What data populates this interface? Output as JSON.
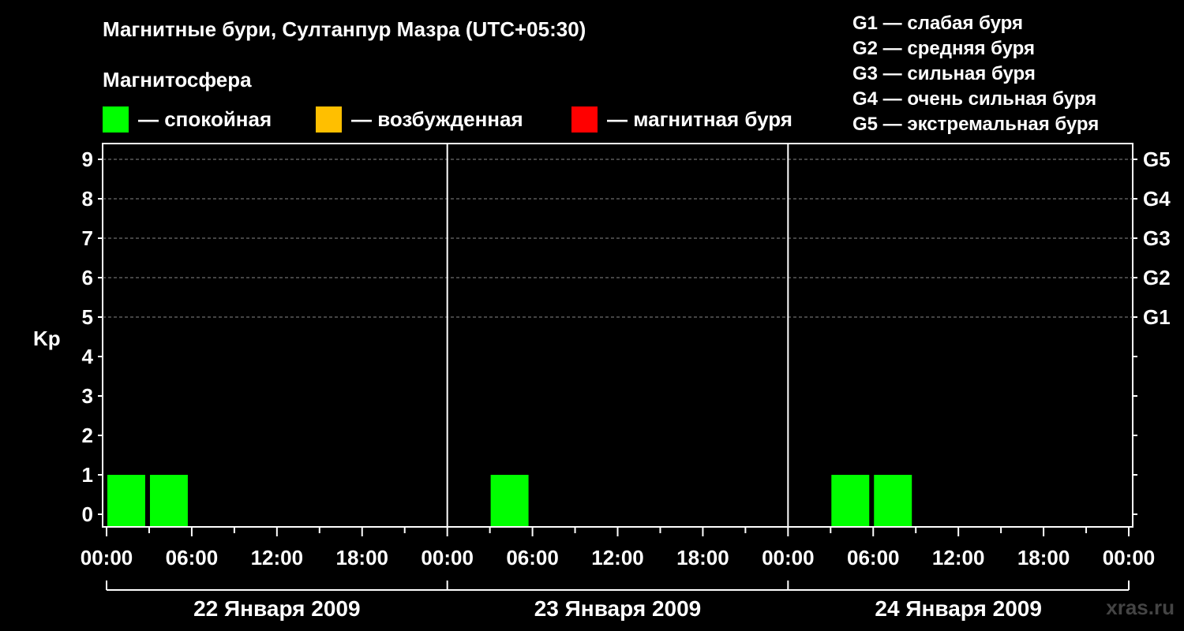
{
  "chart_data": {
    "type": "bar",
    "title": "Магнитные бури, Султанпур Мазра (UTC+05:30)",
    "legend_title": "Магнитосфера",
    "legend": [
      {
        "label": "— спокойная",
        "color": "#00ff00"
      },
      {
        "label": "— возбужденная",
        "color": "#ffbf00"
      },
      {
        "label": "— магнитная буря",
        "color": "#ff0000"
      }
    ],
    "g_scale": [
      "G1 — слабая буря",
      "G2 — средняя буря",
      "G3 — сильная буря",
      "G4 — очень сильная буря",
      "G5 — экстремальная буря"
    ],
    "ylabel": "Kp",
    "ylim": [
      0,
      9
    ],
    "yticks": [
      "0",
      "1",
      "2",
      "3",
      "4",
      "5",
      "6",
      "7",
      "8",
      "9"
    ],
    "right_ticks": [
      {
        "kp": 5,
        "label": "G1"
      },
      {
        "kp": 6,
        "label": "G2"
      },
      {
        "kp": 7,
        "label": "G3"
      },
      {
        "kp": 8,
        "label": "G4"
      },
      {
        "kp": 9,
        "label": "G5"
      }
    ],
    "x_time_labels": [
      "00:00",
      "06:00",
      "12:00",
      "18:00",
      "00:00",
      "06:00",
      "12:00",
      "18:00",
      "00:00",
      "06:00",
      "12:00",
      "18:00",
      "00:00"
    ],
    "days": [
      "22 Января 2009",
      "23 Января 2009",
      "24 Января 2009"
    ],
    "bars": [
      {
        "day": 0,
        "start_hour": 0,
        "end_hour": 3,
        "kp": 1,
        "status": "quiet"
      },
      {
        "day": 0,
        "start_hour": 3,
        "end_hour": 6,
        "kp": 1,
        "status": "quiet"
      },
      {
        "day": 1,
        "start_hour": 3,
        "end_hour": 6,
        "kp": 1,
        "status": "quiet"
      },
      {
        "day": 2,
        "start_hour": 3,
        "end_hour": 6,
        "kp": 1,
        "status": "quiet"
      },
      {
        "day": 2,
        "start_hour": 6,
        "end_hour": 9,
        "kp": 1,
        "status": "quiet"
      }
    ],
    "grid": true
  },
  "watermark": "xras.ru"
}
